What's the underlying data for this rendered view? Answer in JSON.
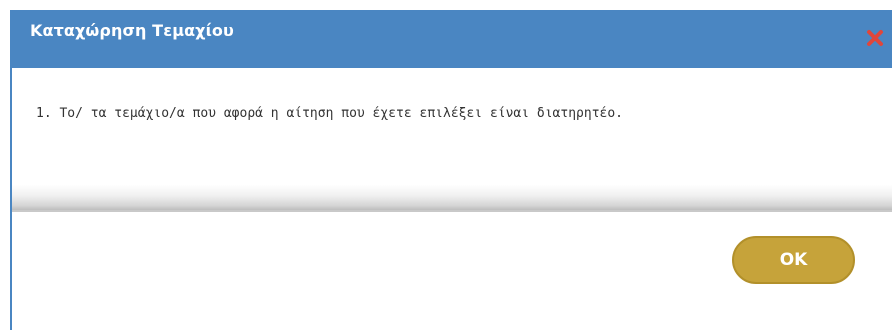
{
  "dialog": {
    "title": "Καταχώρηση Τεμαχίου",
    "message": "1. Το/ τα τεμάχιο/α που αφορά η αίτηση που έχετε επιλέξει είναι διατηρητέο.",
    "ok_label": "OK",
    "close_icon": "close-icon"
  },
  "colors": {
    "titlebar": "#4a86c2",
    "close_icon": "#e0463b",
    "ok_button": "#c6a33a"
  }
}
